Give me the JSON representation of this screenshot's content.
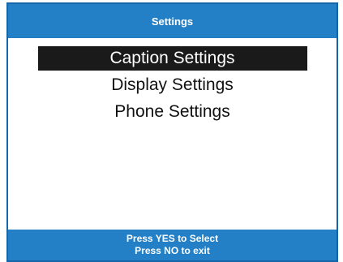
{
  "header": {
    "title": "Settings"
  },
  "menu": {
    "items": [
      {
        "label": "Caption Settings",
        "selected": true
      },
      {
        "label": "Display Settings",
        "selected": false
      },
      {
        "label": "Phone Settings",
        "selected": false
      }
    ]
  },
  "footer": {
    "line1": "Press YES to Select",
    "line2": "Press NO to exit"
  },
  "colors": {
    "bar": "#2480c6",
    "border": "#1565a8",
    "highlight": "#1a1a1a",
    "background": "#ffffff"
  }
}
